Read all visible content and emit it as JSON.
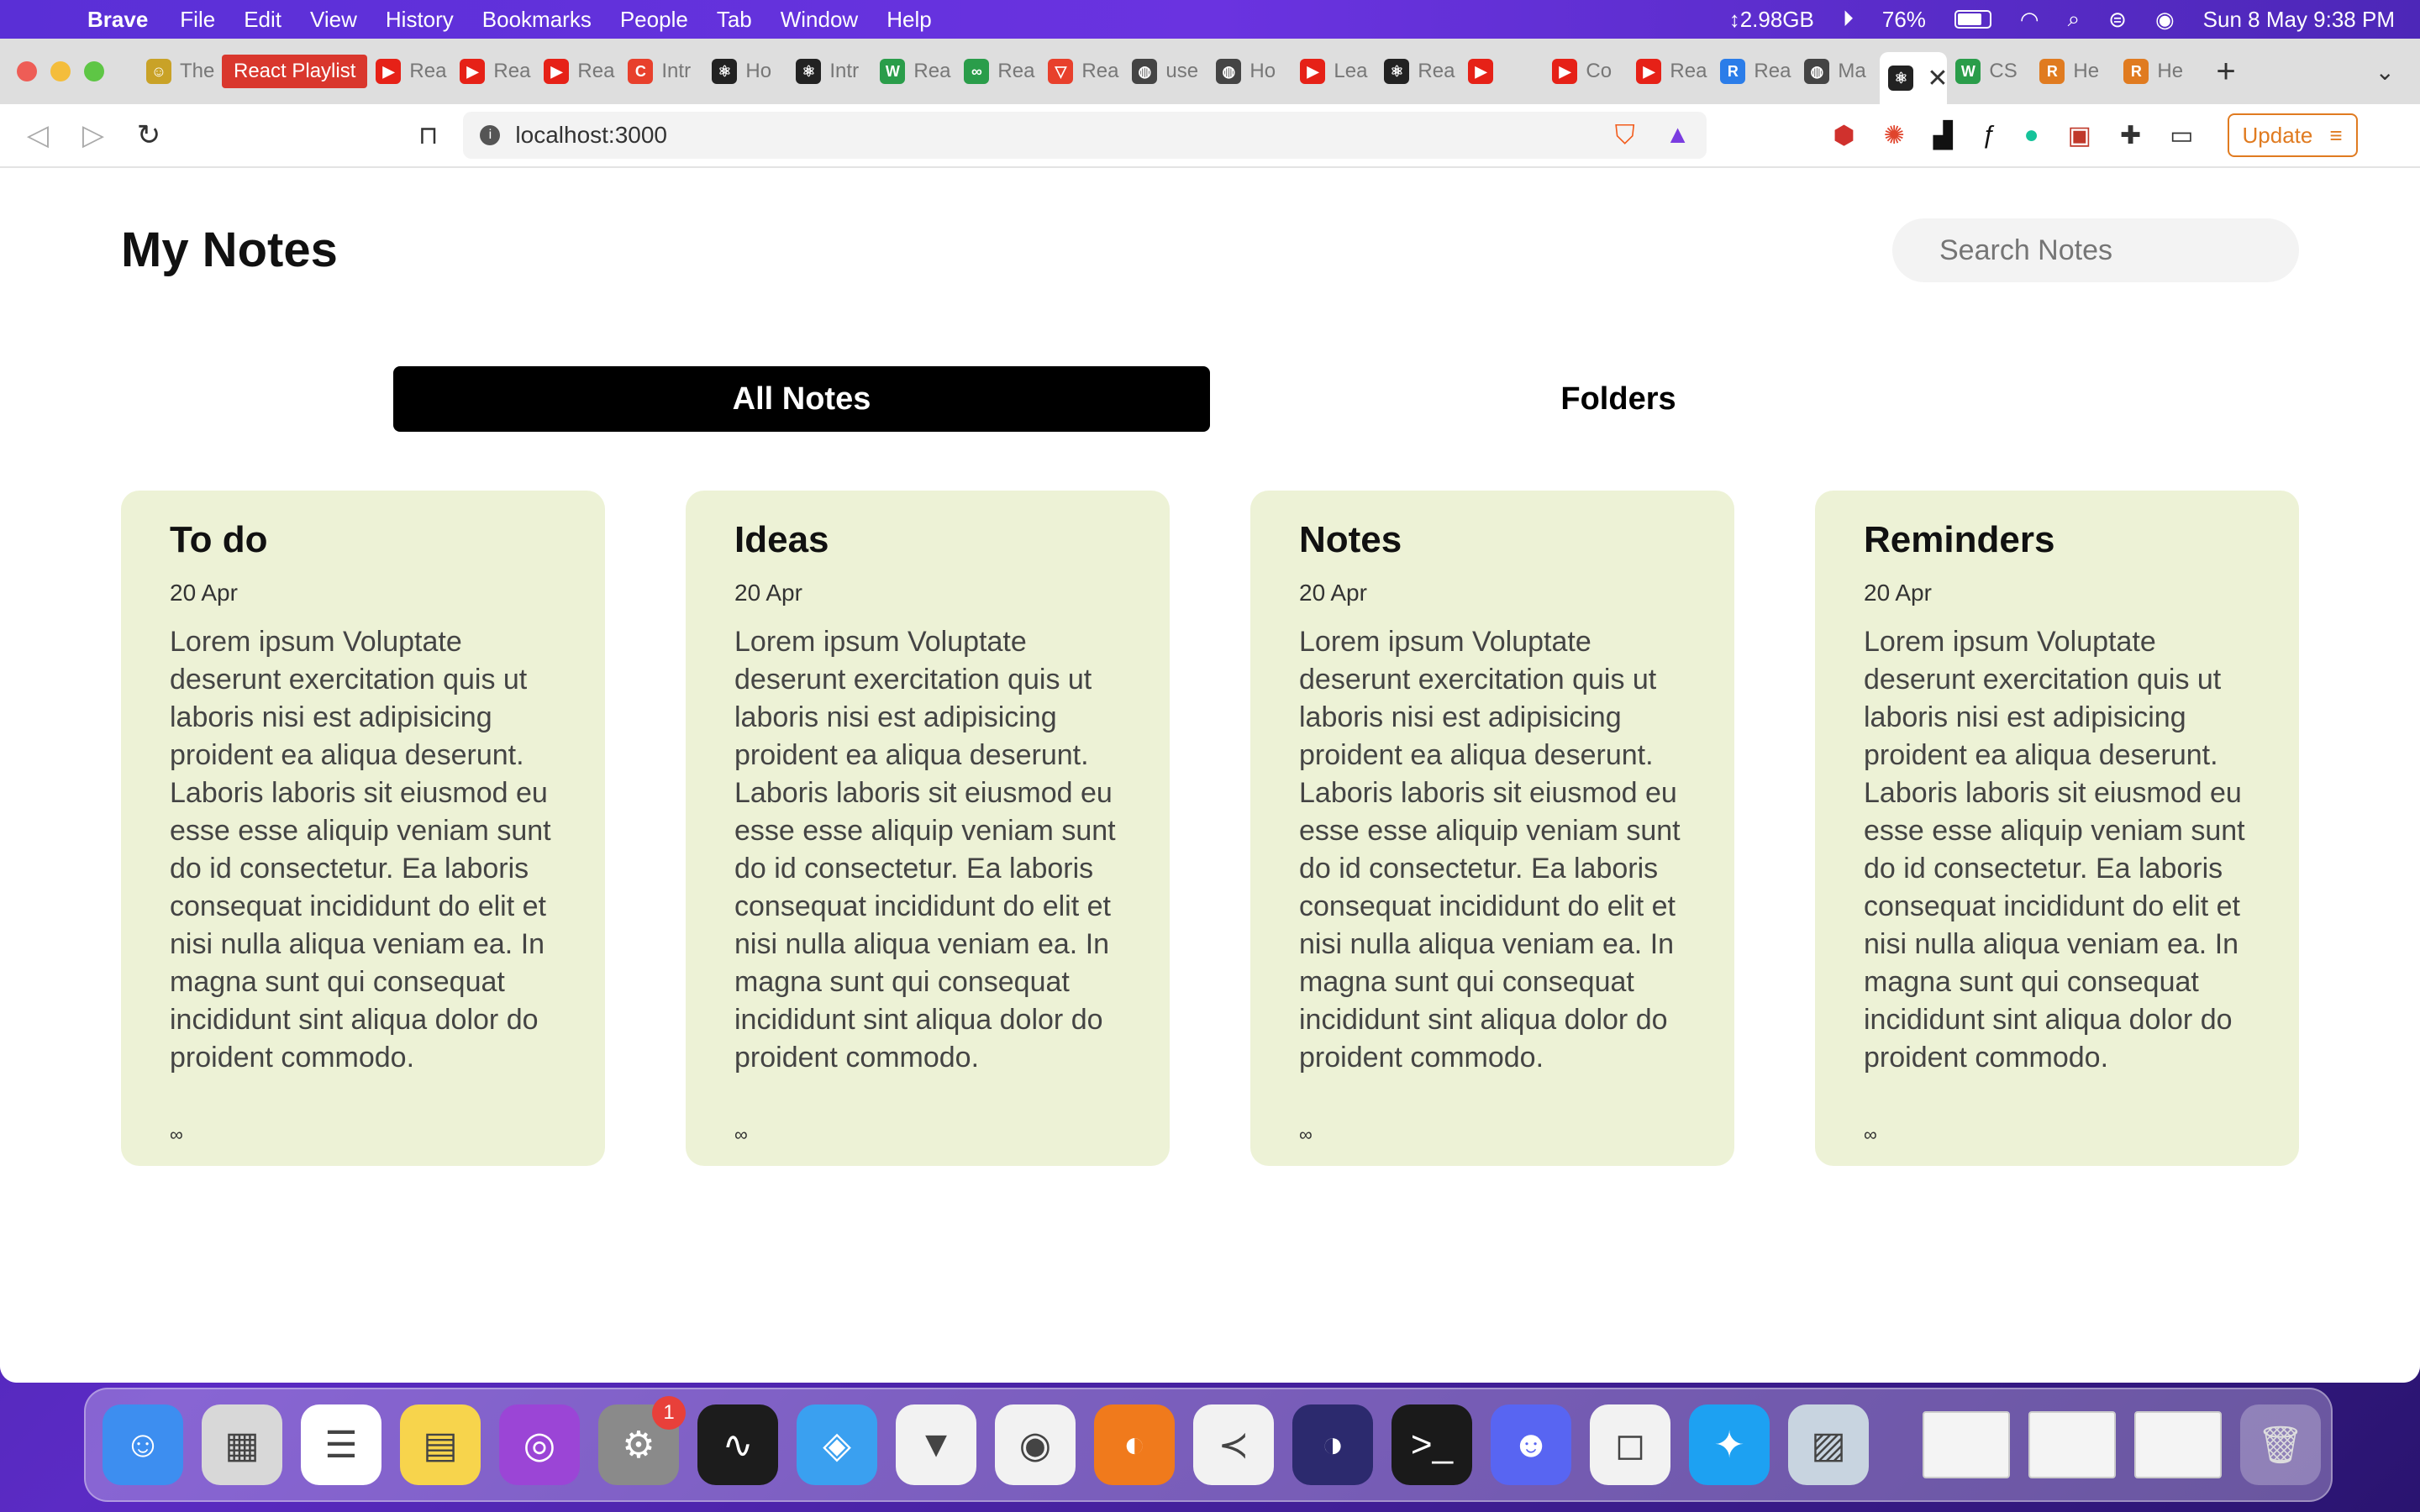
{
  "menubar": {
    "app_name": "Brave",
    "items": [
      "File",
      "Edit",
      "View",
      "History",
      "Bookmarks",
      "People",
      "Tab",
      "Window",
      "Help"
    ],
    "memory": "↕2.98GB",
    "battery": "76%",
    "datetime": "Sun 8 May  9:38 PM"
  },
  "browser": {
    "pinned_tab": "React Playlist",
    "tabs": [
      {
        "label": "The",
        "icon": "user-avatar-icon",
        "color": "#c9a227"
      },
      {
        "label": "Rea",
        "icon": "youtube-icon",
        "color": "#e62117"
      },
      {
        "label": "Rea",
        "icon": "youtube-icon",
        "color": "#e62117"
      },
      {
        "label": "Rea",
        "icon": "youtube-icon",
        "color": "#e62117"
      },
      {
        "label": "Intr",
        "icon": "c-icon",
        "color": "#e8402c"
      },
      {
        "label": "Ho",
        "icon": "react-icon",
        "color": "#222"
      },
      {
        "label": "Intr",
        "icon": "react-icon",
        "color": "#222"
      },
      {
        "label": "Rea",
        "icon": "w-icon",
        "color": "#2a9d4a"
      },
      {
        "label": "Rea",
        "icon": "link-icon",
        "color": "#2a9d4a"
      },
      {
        "label": "Rea",
        "icon": "v-icon",
        "color": "#e8402c"
      },
      {
        "label": "use",
        "icon": "globe-icon",
        "color": "#444"
      },
      {
        "label": "Ho",
        "icon": "globe-icon",
        "color": "#444"
      },
      {
        "label": "Lea",
        "icon": "youtube-icon",
        "color": "#e62117"
      },
      {
        "label": "Rea",
        "icon": "react-icon",
        "color": "#222"
      },
      {
        "label": "",
        "icon": "youtube-icon",
        "color": "#e62117"
      },
      {
        "label": "Co",
        "icon": "youtube-icon",
        "color": "#e62117"
      },
      {
        "label": "Rea",
        "icon": "youtube-icon",
        "color": "#e62117"
      },
      {
        "label": "Rea",
        "icon": "r-icon",
        "color": "#2b7de9"
      },
      {
        "label": "Ma",
        "icon": "globe-icon",
        "color": "#444"
      }
    ],
    "active_tab_close": "✕",
    "tabs_after": [
      {
        "label": "CS",
        "icon": "w-icon",
        "color": "#2a9d4a"
      },
      {
        "label": "He",
        "icon": "r-icon",
        "color": "#e07b20"
      },
      {
        "label": "He",
        "icon": "r-icon",
        "color": "#e07b20"
      }
    ],
    "url": "localhost:3000",
    "update_label": "Update"
  },
  "app": {
    "title": "My Notes",
    "search_placeholder": "Search Notes",
    "tab_all": "All Notes",
    "tab_folders": "Folders",
    "notes": [
      {
        "title": "To do",
        "date": "20 Apr",
        "body": "Lorem ipsum Voluptate deserunt exercitation quis ut laboris nisi est adipisicing proident ea aliqua deserunt. Laboris laboris sit eiusmod eu esse esse aliquip veniam sunt do id consectetur. Ea laboris consequat incididunt do elit et nisi nulla aliqua veniam ea. In magna sunt qui consequat incididunt sint aliqua dolor do proident commodo.",
        "symbol": "∞"
      },
      {
        "title": "Ideas",
        "date": "20 Apr",
        "body": "Lorem ipsum Voluptate deserunt exercitation quis ut laboris nisi est adipisicing proident ea aliqua deserunt. Laboris laboris sit eiusmod eu esse esse aliquip veniam sunt do id consectetur. Ea laboris consequat incididunt do elit et nisi nulla aliqua veniam ea. In magna sunt qui consequat incididunt sint aliqua dolor do proident commodo.",
        "symbol": "∞"
      },
      {
        "title": "Notes",
        "date": "20 Apr",
        "body": "Lorem ipsum Voluptate deserunt exercitation quis ut laboris nisi est adipisicing proident ea aliqua deserunt. Laboris laboris sit eiusmod eu esse esse aliquip veniam sunt do id consectetur. Ea laboris consequat incididunt do elit et nisi nulla aliqua veniam ea. In magna sunt qui consequat incididunt sint aliqua dolor do proident commodo.",
        "symbol": "∞"
      },
      {
        "title": "Reminders",
        "date": "20 Apr",
        "body": "Lorem ipsum Voluptate deserunt exercitation quis ut laboris nisi est adipisicing proident ea aliqua deserunt. Laboris laboris sit eiusmod eu esse esse aliquip veniam sunt do id consectetur. Ea laboris consequat incididunt do elit et nisi nulla aliqua veniam ea. In magna sunt qui consequat incididunt sint aliqua dolor do proident commodo.",
        "symbol": "∞"
      }
    ]
  },
  "dock": {
    "apps": [
      {
        "name": "finder-icon",
        "color": "#3d8ef0"
      },
      {
        "name": "launchpad-icon",
        "color": "#d8d8d8"
      },
      {
        "name": "reminders-icon",
        "color": "#ffffff"
      },
      {
        "name": "notes-icon",
        "color": "#f7d44c"
      },
      {
        "name": "podcasts-icon",
        "color": "#9b45d6"
      },
      {
        "name": "system-preferences-icon",
        "color": "#8a8a8a",
        "badge": "1"
      },
      {
        "name": "activity-monitor-icon",
        "color": "#1c1c1c"
      },
      {
        "name": "safari-icon",
        "color": "#3aa0f0"
      },
      {
        "name": "brave-icon",
        "color": "#f2f2f2"
      },
      {
        "name": "chrome-icon",
        "color": "#f2f2f2"
      },
      {
        "name": "firefox-icon",
        "color": "#f07a1c"
      },
      {
        "name": "vscode-icon",
        "color": "#f2f2f2"
      },
      {
        "name": "eclipse-icon",
        "color": "#2c2a6e"
      },
      {
        "name": "terminal-icon",
        "color": "#1a1a1a"
      },
      {
        "name": "discord-icon",
        "color": "#5865f2"
      },
      {
        "name": "instagram-icon",
        "color": "#f2f2f2"
      },
      {
        "name": "twitter-icon",
        "color": "#1da1f2"
      },
      {
        "name": "preview-icon",
        "color": "#c8d4e0"
      }
    ],
    "thumbnail_count": 3
  }
}
